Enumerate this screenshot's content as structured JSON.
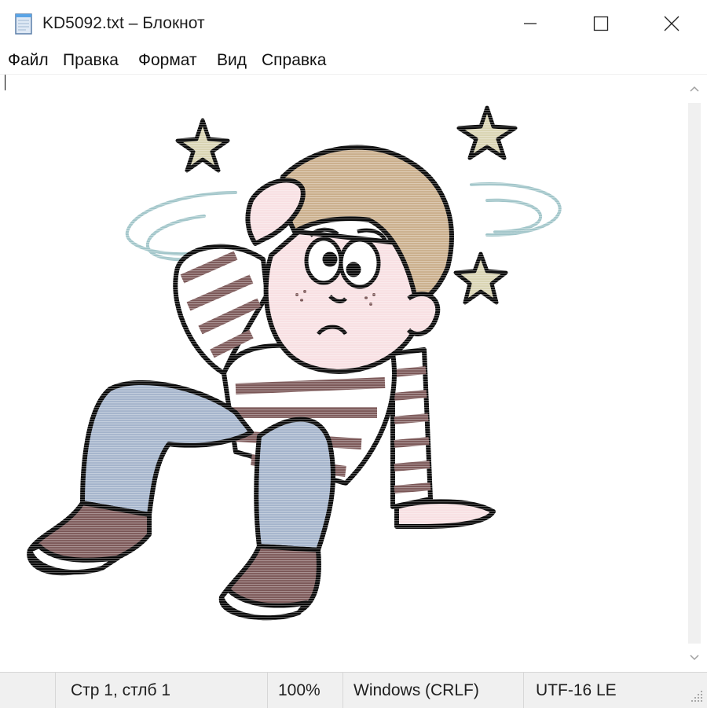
{
  "window": {
    "title": "KD5092.txt – Блокнот",
    "icon": "notepad-icon",
    "controls": [
      "minimize-icon",
      "maximize-icon",
      "close-icon"
    ]
  },
  "menu": {
    "items": [
      "Файл",
      "Правка",
      "Формат",
      "Вид",
      "Справка"
    ]
  },
  "editor": {
    "content_description_icon": "dizzy-boy-ascii-art"
  },
  "statusbar": {
    "position": "Стр 1, стлб 1",
    "zoom": "100%",
    "line_endings": "Windows (CRLF)",
    "encoding": "UTF-16 LE"
  },
  "colors": {
    "outline": "#000000",
    "hair": "#c9ad8a",
    "skin": "#f8dfe2",
    "stripe": "#7a5656",
    "jeans": "#a3b3cb",
    "stars": "#d8d3b1",
    "swirl": "#9fc4c8",
    "status_bg": "#f0f0f0"
  }
}
